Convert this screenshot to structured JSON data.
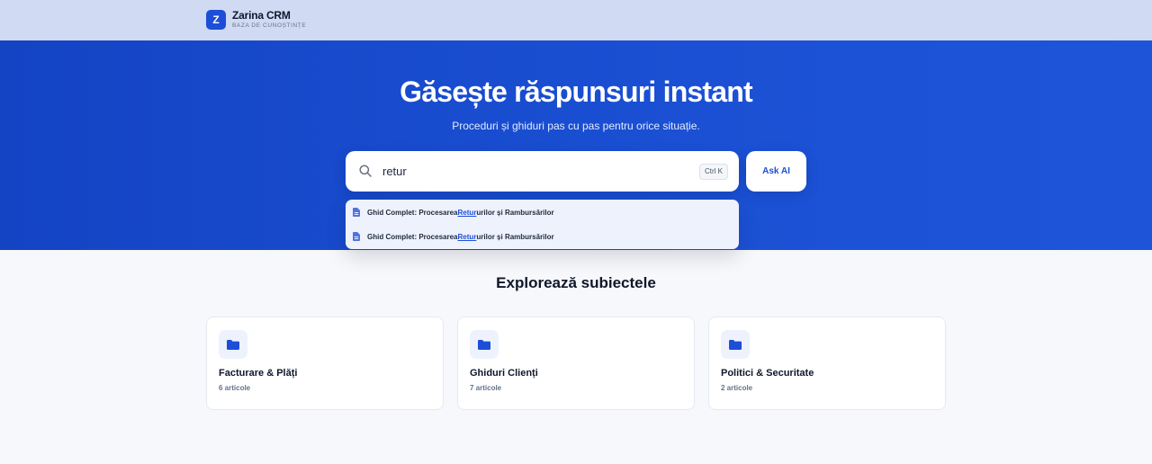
{
  "brand": {
    "logo_letter": "Z",
    "name": "Zarina CRM",
    "subtitle": "BAZA DE CUNOȘTINȚE"
  },
  "hero": {
    "title": "Găsește răspunsuri instant",
    "subtitle": "Proceduri și ghiduri pas cu pas pentru orice situație."
  },
  "search": {
    "value": "retur",
    "shortcut": "Ctrl K",
    "icon": "search-icon"
  },
  "ask_button": {
    "label": "Ask AI"
  },
  "suggestions": [
    {
      "prefix": "Ghid Complet: Procesarea ",
      "match": "Retur",
      "suffix": "urilor și Rambursărilor",
      "icon": "document-icon"
    },
    {
      "prefix": "Ghid Complet: Procesarea ",
      "match": "Retur",
      "suffix": "urilor și Rambursărilor",
      "icon": "document-icon"
    }
  ],
  "topics": {
    "title": "Explorează subiectele",
    "items": [
      {
        "title": "Facturare & Plăți",
        "count": "6 articole",
        "icon": "folder-icon"
      },
      {
        "title": "Ghiduri Clienți",
        "count": "7 articole",
        "icon": "folder-icon"
      },
      {
        "title": "Politici & Securitate",
        "count": "2 articole",
        "icon": "folder-icon"
      }
    ]
  },
  "colors": {
    "accent": "#1d4ed8",
    "hero_bg": "#1b50d4",
    "topbar_bg": "#d0daf3"
  }
}
